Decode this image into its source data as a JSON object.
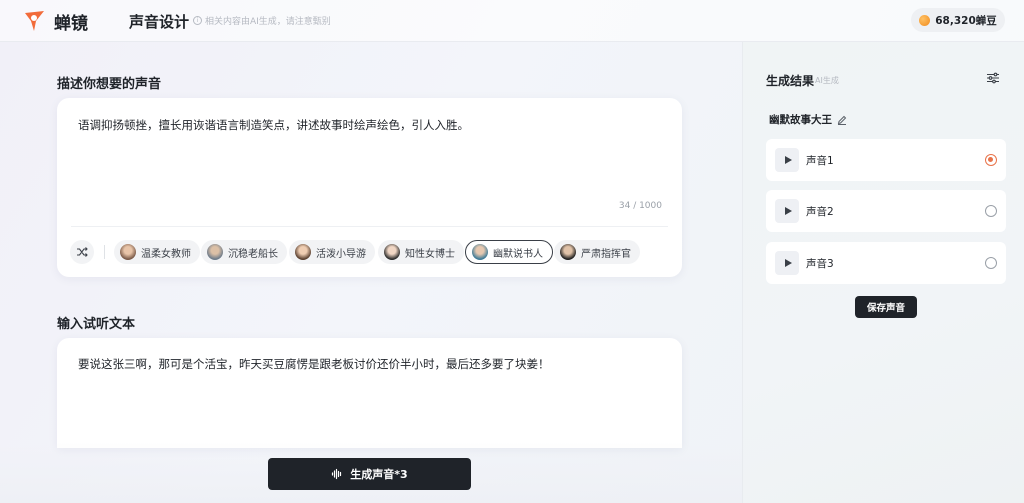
{
  "header": {
    "brand": "蝉镜",
    "page_title": "声音设计",
    "notice": "相关内容由AI生成，请注意甄别",
    "balance": "68,320蝉豆"
  },
  "describe": {
    "title": "描述你想要的声音",
    "text": "语调抑扬顿挫，擅长用诙谐语言制造笑点，讲述故事时绘声绘色，引人入胜。",
    "counter": "34 / 1000",
    "presets": [
      {
        "label": "温柔女教师",
        "selected": false
      },
      {
        "label": "沉稳老船长",
        "selected": false
      },
      {
        "label": "活泼小导游",
        "selected": false
      },
      {
        "label": "知性女博士",
        "selected": false
      },
      {
        "label": "幽默说书人",
        "selected": true
      },
      {
        "label": "严肃指挥官",
        "selected": false
      }
    ]
  },
  "preview": {
    "title": "输入试听文本",
    "text": "要说这张三啊，那可是个活宝，昨天买豆腐愣是跟老板讨价还价半小时，最后还多要了块姜！"
  },
  "generate_label": "生成声音*3",
  "results": {
    "title": "生成结果",
    "subtitle": "AI生成",
    "voice_name": "幽默故事大王",
    "items": [
      {
        "label": "声音1",
        "selected": true
      },
      {
        "label": "声音2",
        "selected": false
      },
      {
        "label": "声音3",
        "selected": false
      }
    ],
    "save_label": "保存声音"
  },
  "colors": {
    "accent": "#e8734a",
    "dark_button": "#1f2329"
  }
}
